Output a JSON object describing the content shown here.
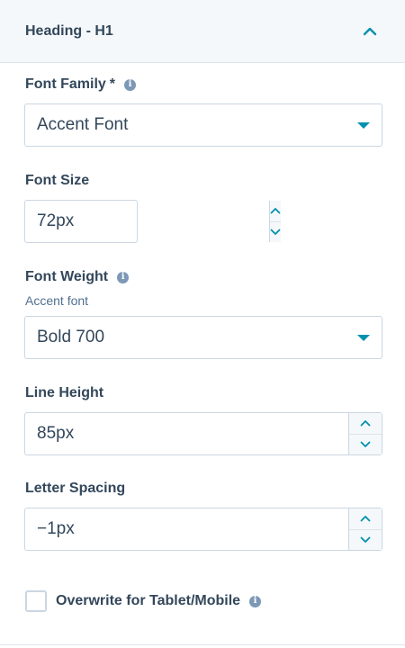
{
  "section": {
    "title": "Heading - H1",
    "expanded": true
  },
  "font_family": {
    "label": "Font Family",
    "required_mark": "*",
    "value": "Accent Font"
  },
  "font_size": {
    "label": "Font Size",
    "value": "72px"
  },
  "font_weight": {
    "label": "Font Weight",
    "sublabel": "Accent font",
    "value": "Bold 700"
  },
  "line_height": {
    "label": "Line Height",
    "value": "85px"
  },
  "letter_spacing": {
    "label": "Letter Spacing",
    "value": "−1px"
  },
  "overwrite": {
    "label": "Overwrite for Tablet/Mobile",
    "checked": false
  },
  "info_glyph": "i",
  "colors": {
    "accent": "#0091ae",
    "text": "#33475b",
    "border": "#cbd6e2",
    "info": "#7c98b6"
  }
}
